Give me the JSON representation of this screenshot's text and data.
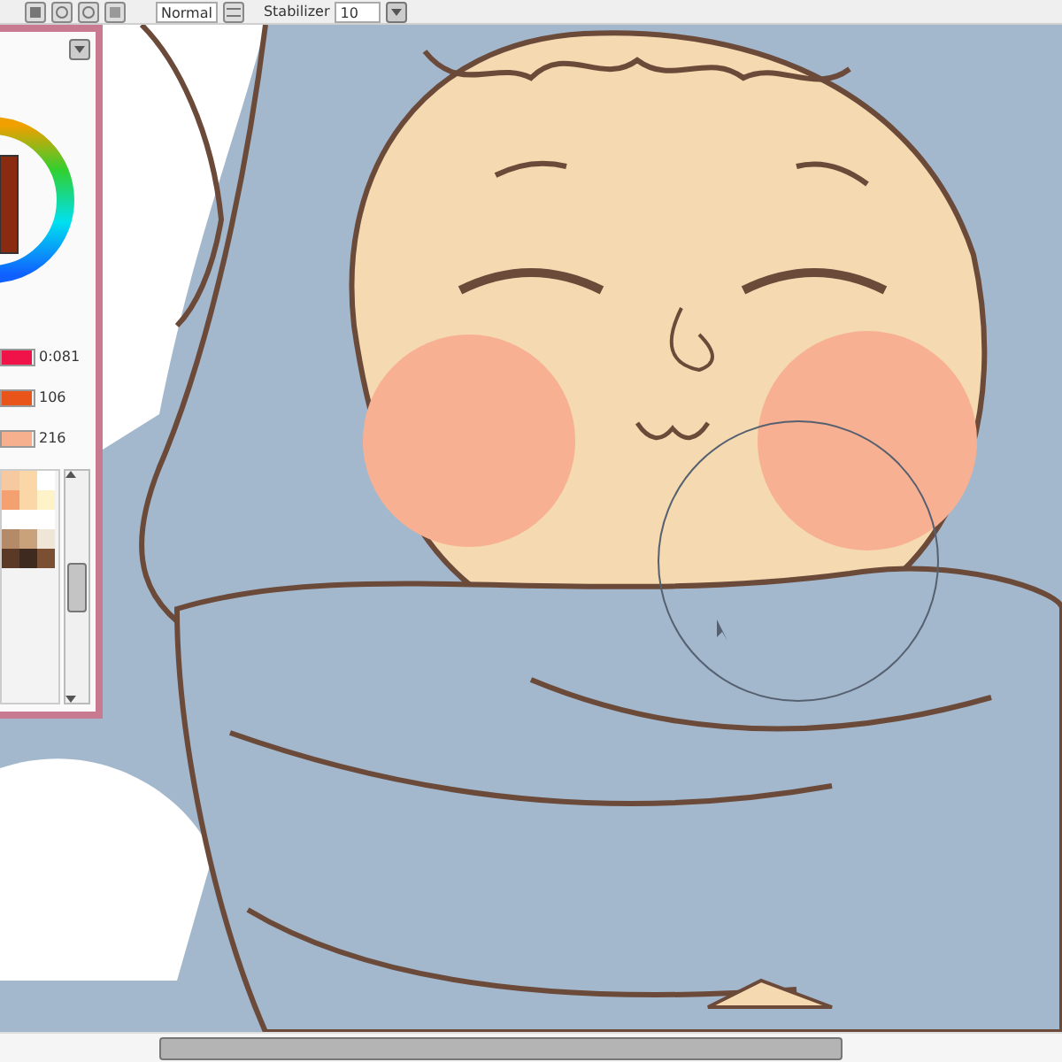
{
  "toolbar": {
    "blend_mode": "Normal",
    "stabilizer_label": "Stabilizer",
    "stabilizer_value": "10"
  },
  "color_panel": {
    "sliders": [
      {
        "reading": "0:081",
        "level": 0.95,
        "color": "#f0134a"
      },
      {
        "reading": "106",
        "level": 0.95,
        "color": "#e8541a"
      },
      {
        "reading": "216",
        "level": 0.95,
        "color": "#f7b08e"
      }
    ],
    "swatches": [
      {
        "color": "#f6c9a0"
      },
      {
        "color": "#fbd7a8"
      },
      {
        "color": "#ffffff"
      },
      {
        "color": "#f4a070"
      },
      {
        "color": "#fbd7a8"
      },
      {
        "color": "#fdf2c8"
      },
      {
        "color": "#ffffff"
      },
      {
        "color": "#ffffff"
      },
      {
        "color": "#ffffff"
      },
      {
        "color": "#b58a68"
      },
      {
        "color": "#c9a27c"
      },
      {
        "color": "#efe6d8"
      },
      {
        "color": "#5a3a26"
      },
      {
        "color": "#3e2a1e"
      },
      {
        "color": "#7a4f33"
      }
    ]
  }
}
